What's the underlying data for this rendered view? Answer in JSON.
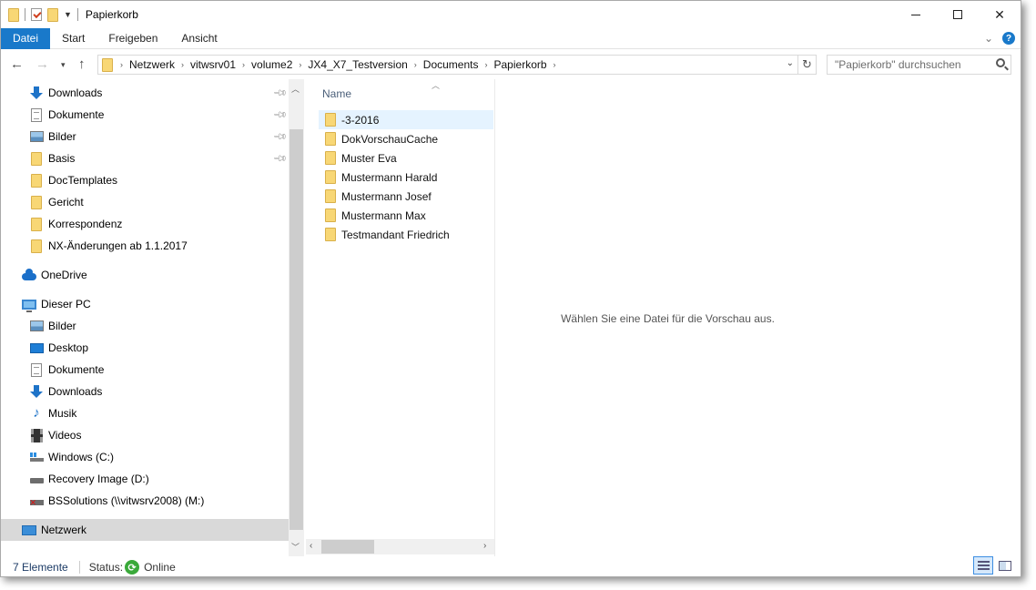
{
  "window": {
    "title": "Papierkorb"
  },
  "ribbon": {
    "tabs": [
      "Datei",
      "Start",
      "Freigeben",
      "Ansicht"
    ]
  },
  "address": {
    "crumbs": [
      "Netzwerk",
      "vitwsrv01",
      "volume2",
      "JX4_X7_Testversion",
      "Documents",
      "Papierkorb"
    ]
  },
  "search": {
    "placeholder": "\"Papierkorb\" durchsuchen"
  },
  "nav_pane": {
    "quick_access": [
      {
        "label": "Downloads",
        "icon": "download-icon",
        "pinned": true
      },
      {
        "label": "Dokumente",
        "icon": "document-icon",
        "pinned": true
      },
      {
        "label": "Bilder",
        "icon": "pictures-icon",
        "pinned": true
      },
      {
        "label": "Basis",
        "icon": "folder-icon",
        "pinned": true
      },
      {
        "label": "DocTemplates",
        "icon": "folder-icon",
        "pinned": false
      },
      {
        "label": "Gericht",
        "icon": "folder-icon",
        "pinned": false
      },
      {
        "label": "Korrespondenz",
        "icon": "folder-icon",
        "pinned": false
      },
      {
        "label": "NX-Änderungen ab 1.1.2017",
        "icon": "folder-icon",
        "pinned": false
      }
    ],
    "onedrive": "OneDrive",
    "this_pc": "Dieser PC",
    "pc_items": [
      {
        "label": "Bilder",
        "icon": "pictures-icon"
      },
      {
        "label": "Desktop",
        "icon": "desktop-icon"
      },
      {
        "label": "Dokumente",
        "icon": "document-icon"
      },
      {
        "label": "Downloads",
        "icon": "download-icon"
      },
      {
        "label": "Musik",
        "icon": "music-icon"
      },
      {
        "label": "Videos",
        "icon": "video-icon"
      },
      {
        "label": "Windows (C:)",
        "icon": "windows-drive-icon"
      },
      {
        "label": "Recovery Image (D:)",
        "icon": "drive-icon"
      },
      {
        "label": "BSSolutions (\\\\vitwsrv2008) (M:)",
        "icon": "network-drive-disconnected-icon"
      }
    ],
    "network": "Netzwerk"
  },
  "file_list": {
    "column_name": "Name",
    "items": [
      "-3-2016",
      "DokVorschauCache",
      "Muster Eva",
      "Mustermann Harald",
      "Mustermann Josef",
      "Mustermann Max",
      "Testmandant Friedrich"
    ]
  },
  "preview": {
    "message": "Wählen Sie eine Datei für die Vorschau aus."
  },
  "status_bar": {
    "item_count": "7 Elemente",
    "status_label": "Status:",
    "status_value": "Online"
  },
  "colors": {
    "file_tab": "#1979ca",
    "selection_bg": "#e5f3ff",
    "nav_selected": "#d9d9d9",
    "folder": "#f8d775"
  }
}
